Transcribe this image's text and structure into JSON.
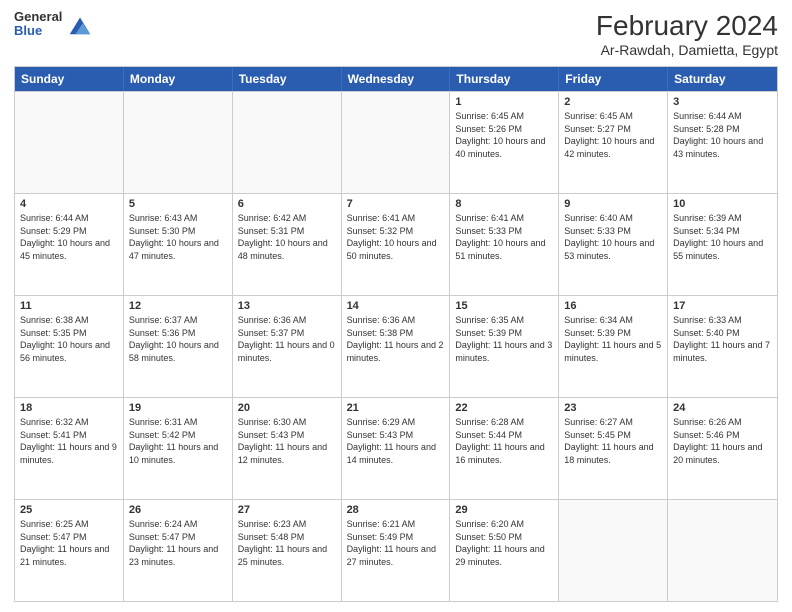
{
  "header": {
    "logo_general": "General",
    "logo_blue": "Blue",
    "month_year": "February 2024",
    "location": "Ar-Rawdah, Damietta, Egypt"
  },
  "days_of_week": [
    "Sunday",
    "Monday",
    "Tuesday",
    "Wednesday",
    "Thursday",
    "Friday",
    "Saturday"
  ],
  "weeks": [
    [
      {
        "day": "",
        "empty": true
      },
      {
        "day": "",
        "empty": true
      },
      {
        "day": "",
        "empty": true
      },
      {
        "day": "",
        "empty": true
      },
      {
        "day": "1",
        "sunrise": "6:45 AM",
        "sunset": "5:26 PM",
        "daylight": "10 hours and 40 minutes."
      },
      {
        "day": "2",
        "sunrise": "6:45 AM",
        "sunset": "5:27 PM",
        "daylight": "10 hours and 42 minutes."
      },
      {
        "day": "3",
        "sunrise": "6:44 AM",
        "sunset": "5:28 PM",
        "daylight": "10 hours and 43 minutes."
      }
    ],
    [
      {
        "day": "4",
        "sunrise": "6:44 AM",
        "sunset": "5:29 PM",
        "daylight": "10 hours and 45 minutes."
      },
      {
        "day": "5",
        "sunrise": "6:43 AM",
        "sunset": "5:30 PM",
        "daylight": "10 hours and 47 minutes."
      },
      {
        "day": "6",
        "sunrise": "6:42 AM",
        "sunset": "5:31 PM",
        "daylight": "10 hours and 48 minutes."
      },
      {
        "day": "7",
        "sunrise": "6:41 AM",
        "sunset": "5:32 PM",
        "daylight": "10 hours and 50 minutes."
      },
      {
        "day": "8",
        "sunrise": "6:41 AM",
        "sunset": "5:33 PM",
        "daylight": "10 hours and 51 minutes."
      },
      {
        "day": "9",
        "sunrise": "6:40 AM",
        "sunset": "5:33 PM",
        "daylight": "10 hours and 53 minutes."
      },
      {
        "day": "10",
        "sunrise": "6:39 AM",
        "sunset": "5:34 PM",
        "daylight": "10 hours and 55 minutes."
      }
    ],
    [
      {
        "day": "11",
        "sunrise": "6:38 AM",
        "sunset": "5:35 PM",
        "daylight": "10 hours and 56 minutes."
      },
      {
        "day": "12",
        "sunrise": "6:37 AM",
        "sunset": "5:36 PM",
        "daylight": "10 hours and 58 minutes."
      },
      {
        "day": "13",
        "sunrise": "6:36 AM",
        "sunset": "5:37 PM",
        "daylight": "11 hours and 0 minutes."
      },
      {
        "day": "14",
        "sunrise": "6:36 AM",
        "sunset": "5:38 PM",
        "daylight": "11 hours and 2 minutes."
      },
      {
        "day": "15",
        "sunrise": "6:35 AM",
        "sunset": "5:39 PM",
        "daylight": "11 hours and 3 minutes."
      },
      {
        "day": "16",
        "sunrise": "6:34 AM",
        "sunset": "5:39 PM",
        "daylight": "11 hours and 5 minutes."
      },
      {
        "day": "17",
        "sunrise": "6:33 AM",
        "sunset": "5:40 PM",
        "daylight": "11 hours and 7 minutes."
      }
    ],
    [
      {
        "day": "18",
        "sunrise": "6:32 AM",
        "sunset": "5:41 PM",
        "daylight": "11 hours and 9 minutes."
      },
      {
        "day": "19",
        "sunrise": "6:31 AM",
        "sunset": "5:42 PM",
        "daylight": "11 hours and 10 minutes."
      },
      {
        "day": "20",
        "sunrise": "6:30 AM",
        "sunset": "5:43 PM",
        "daylight": "11 hours and 12 minutes."
      },
      {
        "day": "21",
        "sunrise": "6:29 AM",
        "sunset": "5:43 PM",
        "daylight": "11 hours and 14 minutes."
      },
      {
        "day": "22",
        "sunrise": "6:28 AM",
        "sunset": "5:44 PM",
        "daylight": "11 hours and 16 minutes."
      },
      {
        "day": "23",
        "sunrise": "6:27 AM",
        "sunset": "5:45 PM",
        "daylight": "11 hours and 18 minutes."
      },
      {
        "day": "24",
        "sunrise": "6:26 AM",
        "sunset": "5:46 PM",
        "daylight": "11 hours and 20 minutes."
      }
    ],
    [
      {
        "day": "25",
        "sunrise": "6:25 AM",
        "sunset": "5:47 PM",
        "daylight": "11 hours and 21 minutes."
      },
      {
        "day": "26",
        "sunrise": "6:24 AM",
        "sunset": "5:47 PM",
        "daylight": "11 hours and 23 minutes."
      },
      {
        "day": "27",
        "sunrise": "6:23 AM",
        "sunset": "5:48 PM",
        "daylight": "11 hours and 25 minutes."
      },
      {
        "day": "28",
        "sunrise": "6:21 AM",
        "sunset": "5:49 PM",
        "daylight": "11 hours and 27 minutes."
      },
      {
        "day": "29",
        "sunrise": "6:20 AM",
        "sunset": "5:50 PM",
        "daylight": "11 hours and 29 minutes."
      },
      {
        "day": "",
        "empty": true
      },
      {
        "day": "",
        "empty": true
      }
    ]
  ]
}
